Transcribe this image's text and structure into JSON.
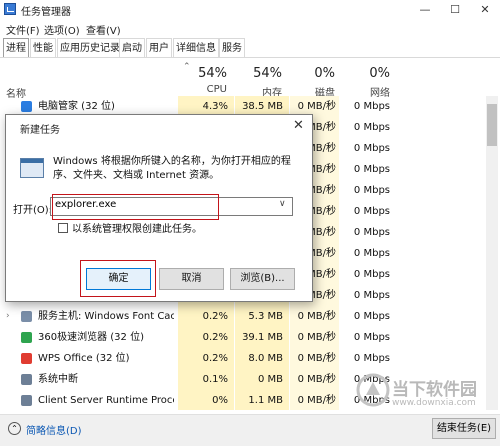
{
  "window": {
    "title": "任务管理器",
    "controls": {
      "minimize": "—",
      "maximize": "☐",
      "close": "✕"
    }
  },
  "menu": [
    "文件(F)",
    "选项(O)",
    "查看(V)"
  ],
  "tabs": [
    "进程",
    "性能",
    "应用历史记录",
    "启动",
    "用户",
    "详细信息",
    "服务"
  ],
  "columns": {
    "name": "名称",
    "cpu": {
      "pct": "54%",
      "label": "CPU"
    },
    "memory": {
      "pct": "54%",
      "label": "内存"
    },
    "disk": {
      "pct": "0%",
      "label": "磁盘"
    },
    "network": {
      "pct": "0%",
      "label": "网络"
    }
  },
  "processes": [
    {
      "name": "电脑管家 (32 位)",
      "cpu": "4.3%",
      "memory": "38.5 MB",
      "disk": "0 MB/秒",
      "network": "0 Mbps",
      "icon": "shield-icon",
      "icon_color": "#2b7de1",
      "expandable": false
    },
    {
      "name": "",
      "cpu": "",
      "memory": "",
      "disk": "0 MB/秒",
      "network": "0 Mbps",
      "icon": "",
      "expandable": false
    },
    {
      "name": "",
      "cpu": "",
      "memory": "",
      "disk": "0 MB/秒",
      "network": "0 Mbps",
      "icon": "",
      "expandable": false
    },
    {
      "name": "",
      "cpu": "",
      "memory": "",
      "disk": "0 MB/秒",
      "network": "0 Mbps",
      "icon": "",
      "expandable": false
    },
    {
      "name": "",
      "cpu": "",
      "memory": "",
      "disk": "0 MB/秒",
      "network": "0 Mbps",
      "icon": "",
      "expandable": false
    },
    {
      "name": "",
      "cpu": "",
      "memory": "",
      "disk": "0 MB/秒",
      "network": "0 Mbps",
      "icon": "",
      "expandable": false
    },
    {
      "name": "",
      "cpu": "",
      "memory": "",
      "disk": "0 MB/秒",
      "network": "0 Mbps",
      "icon": "",
      "expandable": false
    },
    {
      "name": "",
      "cpu": "",
      "memory": "",
      "disk": "0 MB/秒",
      "network": "0 Mbps",
      "icon": "",
      "expandable": false
    },
    {
      "name": "",
      "cpu": "",
      "memory": "",
      "disk": "0 MB/秒",
      "network": "0 Mbps",
      "icon": "",
      "expandable": false
    },
    {
      "name": "",
      "cpu": "",
      "memory": "",
      "disk": "0 MB/秒",
      "network": "0 Mbps",
      "icon": "",
      "expandable": false
    },
    {
      "name": "服务主机: Windows Font Cac...",
      "cpu": "0.2%",
      "memory": "5.3 MB",
      "disk": "0 MB/秒",
      "network": "0 Mbps",
      "icon": "gear-icon",
      "icon_color": "#7a8ea8",
      "expandable": true
    },
    {
      "name": "360极速浏览器 (32 位)",
      "cpu": "0.2%",
      "memory": "39.1 MB",
      "disk": "0 MB/秒",
      "network": "0 Mbps",
      "icon": "browser-icon",
      "icon_color": "#2ea44f",
      "expandable": false
    },
    {
      "name": "WPS Office (32 位)",
      "cpu": "0.2%",
      "memory": "8.0 MB",
      "disk": "0 MB/秒",
      "network": "0 Mbps",
      "icon": "wps-icon",
      "icon_color": "#e03c31",
      "expandable": false
    },
    {
      "name": "系统中断",
      "cpu": "0.1%",
      "memory": "0 MB",
      "disk": "0 MB/秒",
      "network": "0 Mbps",
      "icon": "system-icon",
      "icon_color": "#6d7f96",
      "expandable": false
    },
    {
      "name": "Client Server Runtime Process",
      "cpu": "0%",
      "memory": "1.1 MB",
      "disk": "0 MB/秒",
      "network": "0 Mbps",
      "icon": "system-icon",
      "icon_color": "#6d7f96",
      "expandable": false
    }
  ],
  "footer": {
    "less_details": "简略信息(D)",
    "end_task": "结束任务(E)"
  },
  "dialog": {
    "title": "新建任务",
    "close": "✕",
    "description": "Windows 将根据你所键入的名称，为你打开相应的程序、文件夹、文档或 Internet 资源。",
    "open_label": "打开(O):",
    "open_value": "explorer.exe",
    "admin_label": "以系统管理权限创建此任务。",
    "ok": "确定",
    "cancel": "取消",
    "browse": "浏览(B)..."
  },
  "watermark": {
    "text": "当下软件园",
    "url": "www.downxia.com"
  },
  "colors": {
    "highlight_box": "#c3141a",
    "cpu_band": "#fff4c4",
    "accent": "#0078d7"
  }
}
